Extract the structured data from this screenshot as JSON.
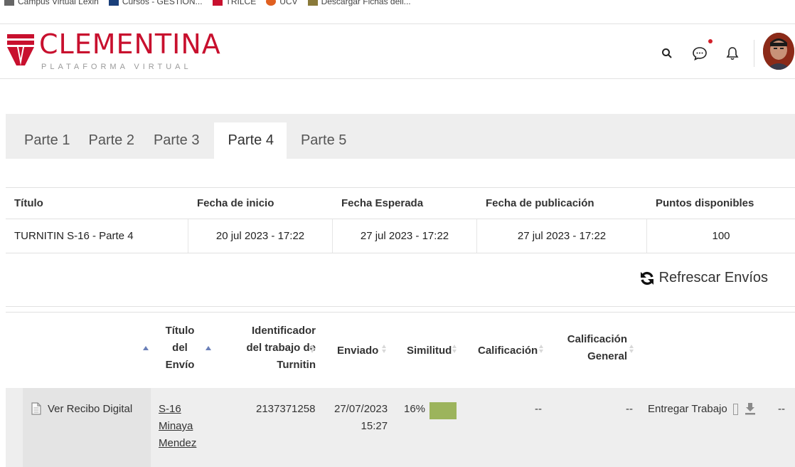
{
  "bookmarks": [
    {
      "label": "Campus Virtual Lexin",
      "color": "#555555"
    },
    {
      "label": "Cursos - GESTION...",
      "color": "#1a3f7a"
    },
    {
      "label": "TRILCE",
      "color": "#c8102e"
    },
    {
      "label": "UCV",
      "color": "#e06020"
    },
    {
      "label": "Descargar Fichas dell...",
      "color": "#8a7a3a"
    }
  ],
  "header": {
    "title": "CLEMENTINA",
    "subtitle": "PLATAFORMA VIRTUAL",
    "brand_color": "#c8102e",
    "icons": [
      "search-icon",
      "chat-icon",
      "bell-icon"
    ]
  },
  "tabs": [
    {
      "label": "Parte 1",
      "active": false
    },
    {
      "label": "Parte 2",
      "active": false
    },
    {
      "label": "Parte 3",
      "active": false
    },
    {
      "label": "Parte 4",
      "active": true
    },
    {
      "label": "Parte 5",
      "active": false
    }
  ],
  "assignment": {
    "headers": [
      "Título",
      "Fecha de inicio",
      "Fecha Esperada",
      "Fecha de publicación",
      "Puntos disponibles"
    ],
    "values": [
      "TURNITIN S-16 - Parte 4",
      "20 jul 2023 - 17:22",
      "27 jul 2023 - 17:22",
      "27 jul 2023 - 17:22",
      "100"
    ]
  },
  "refresh_label": "Refrescar Envíos",
  "submissions": {
    "headers": {
      "titulo_l1": "Título",
      "titulo_l2": "del",
      "titulo_l3": "Envío",
      "id_l1": "Identificador",
      "id_l2": "del trabajo de",
      "id_l3": "Turnitin",
      "enviado": "Enviado",
      "similitud": "Similitud",
      "calificacion": "Calificación",
      "general_l1": "Calificación",
      "general_l2": "General"
    },
    "row": {
      "recibo": "Ver Recibo Digital",
      "titulo_l1": "S-16",
      "titulo_l2": "Minaya",
      "titulo_l3": "Mendez",
      "id": "2137371258",
      "enviado_l1": "27/07/2023",
      "enviado_l2": "15:27",
      "similitud": "16%",
      "similitud_color": "#9cb45c",
      "calificacion": "--",
      "general": "--",
      "entregar": "Entregar Trabajo",
      "extra": "--"
    }
  }
}
